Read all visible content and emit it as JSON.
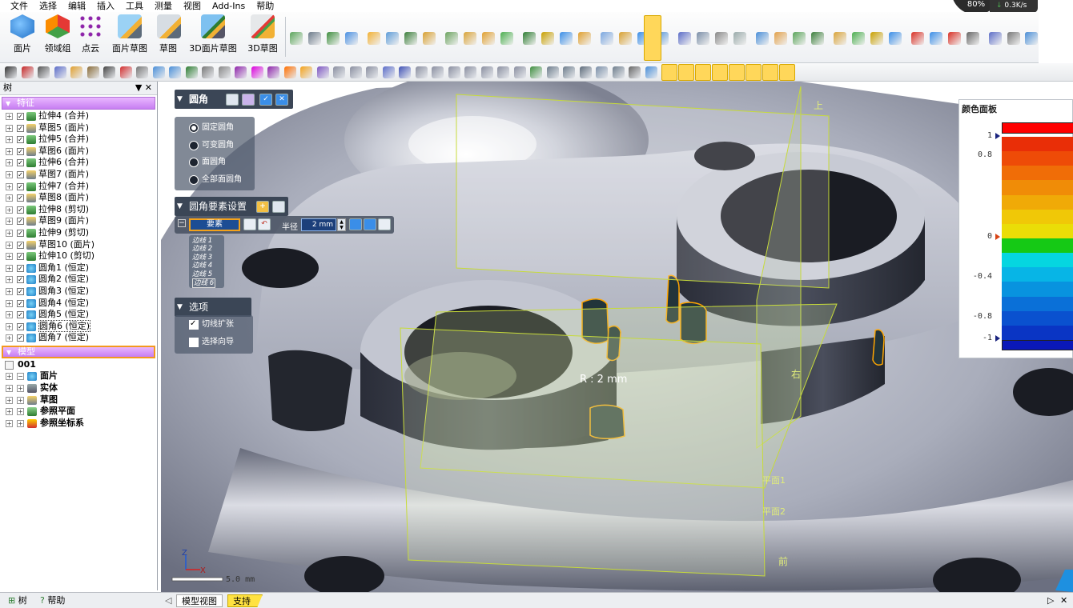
{
  "menu": [
    "文件",
    "选择",
    "编辑",
    "插入",
    "工具",
    "测量",
    "视图",
    "Add-Ins",
    "帮助"
  ],
  "perf": {
    "value": "0.3K/s",
    "pct": "80%"
  },
  "ribbon": {
    "big_buttons": [
      "面片",
      "领域组",
      "点云",
      "面片草图",
      "草图",
      "3D面片草图",
      "3D草图"
    ]
  },
  "tree": {
    "title": "树",
    "controls": "▼ ✕",
    "features_header": "特征",
    "features": [
      {
        "label": "拉伸4 (合并)",
        "icon": "extrude"
      },
      {
        "label": "草图5 (面片)",
        "icon": "sketch"
      },
      {
        "label": "拉伸5 (合并)",
        "icon": "extrude"
      },
      {
        "label": "草图6 (面片)",
        "icon": "sketch"
      },
      {
        "label": "拉伸6 (合并)",
        "icon": "extrude"
      },
      {
        "label": "草图7 (面片)",
        "icon": "sketch"
      },
      {
        "label": "拉伸7 (合并)",
        "icon": "extrude"
      },
      {
        "label": "草图8 (面片)",
        "icon": "sketch"
      },
      {
        "label": "拉伸8 (剪切)",
        "icon": "extrude"
      },
      {
        "label": "草图9 (面片)",
        "icon": "sketch"
      },
      {
        "label": "拉伸9 (剪切)",
        "icon": "extrude"
      },
      {
        "label": "草图10 (面片)",
        "icon": "sketch"
      },
      {
        "label": "拉伸10 (剪切)",
        "icon": "extrude"
      },
      {
        "label": "圆角1 (恒定)",
        "icon": "fillet"
      },
      {
        "label": "圆角2 (恒定)",
        "icon": "fillet"
      },
      {
        "label": "圆角3 (恒定)",
        "icon": "fillet"
      },
      {
        "label": "圆角4 (恒定)",
        "icon": "fillet"
      },
      {
        "label": "圆角5 (恒定)",
        "icon": "fillet"
      },
      {
        "label": "圆角6 (恒定)",
        "icon": "fillet"
      },
      {
        "label": "圆角7 (恒定)",
        "icon": "fillet"
      }
    ],
    "model_header": "模型",
    "model_root": "001",
    "model_items": [
      "面片",
      "实体",
      "草图",
      "参照平面",
      "参照坐标系"
    ]
  },
  "bottom_tabs": {
    "tree": "树",
    "help": "帮助",
    "model_view": "模型视图",
    "support": "支持"
  },
  "fillet_panel": {
    "title": "圆角",
    "options": [
      "固定圆角",
      "可变圆角",
      "面圆角",
      "全部面圆角"
    ],
    "selected_option": 0,
    "elements_title": "圆角要素设置",
    "element_field": "要素",
    "radius_label": "半径",
    "radius_value": "2 mm",
    "edges": [
      "边线 1",
      "边线 2",
      "边线 3",
      "边线 4",
      "边线 5",
      "边线 6"
    ],
    "options_title": "选项",
    "checkboxes": [
      {
        "label": "切线扩张",
        "checked": true
      },
      {
        "label": "选择向导",
        "checked": false
      }
    ]
  },
  "viewport": {
    "radius_annotation": "R : 2 mm",
    "scale_label": "5.0 mm",
    "plane_labels": {
      "top": "上",
      "right": "右",
      "plane1": "平面1",
      "plane2": "平面2",
      "front": "前"
    },
    "axes": {
      "z": "Z",
      "x": "X"
    }
  },
  "color_panel": {
    "title": "颜色面板",
    "ticks": [
      "1",
      "0.8",
      "0",
      "-0.4",
      "-0.8",
      "-1"
    ],
    "colors": [
      "#ff0000",
      "#e92e07",
      "#ee4b07",
      "#f06d07",
      "#f08c07",
      "#f0aa07",
      "#f0c807",
      "#eadd07",
      "#15c915",
      "#05d6e0",
      "#07b5e6",
      "#0893df",
      "#0a70d8",
      "#0a51cf",
      "#0a35c4",
      "#0a18b8"
    ]
  }
}
